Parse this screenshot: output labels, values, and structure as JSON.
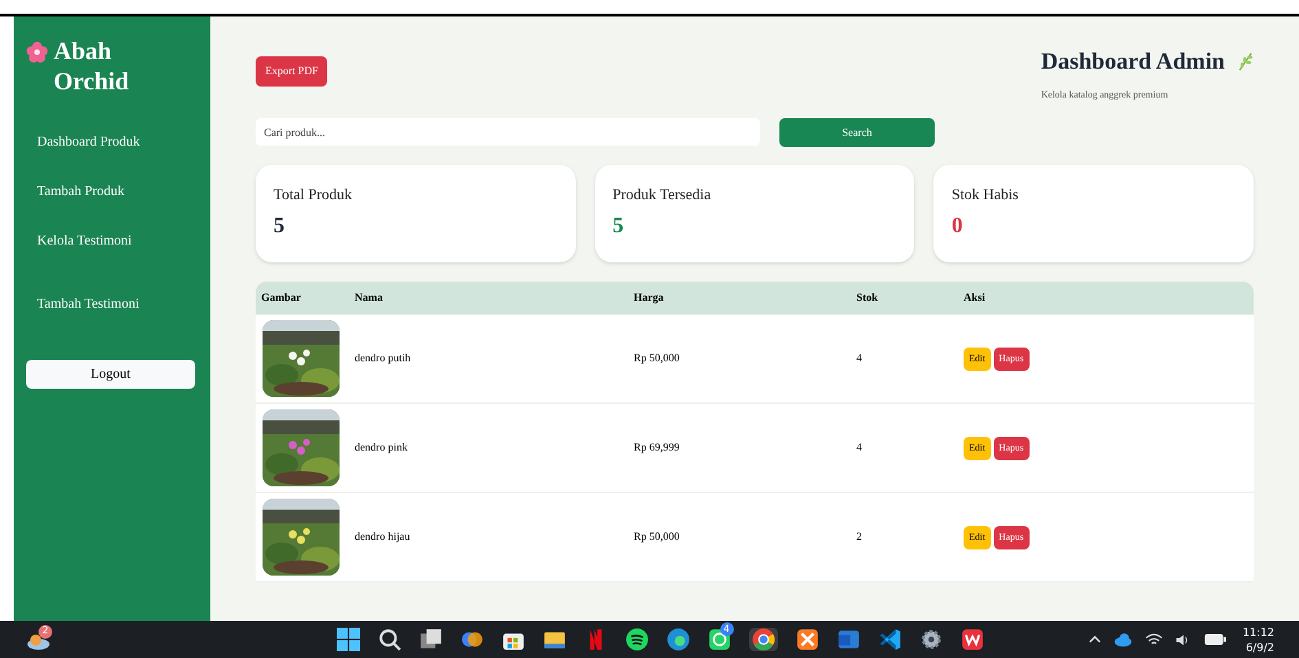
{
  "sidebar": {
    "brand": "Abah Orchid",
    "items": [
      {
        "label": "Dashboard Produk"
      },
      {
        "label": "Tambah Produk"
      },
      {
        "label": "Kelola Testimoni"
      },
      {
        "label": "Tambah Testimoni"
      }
    ],
    "logout": "Logout"
  },
  "header": {
    "export_button": "Export PDF",
    "title": "Dashboard Admin",
    "subtitle": "Kelola katalog anggrek premium"
  },
  "search": {
    "placeholder": "Cari produk...",
    "button": "Search"
  },
  "stats": [
    {
      "label": "Total Produk",
      "value": "5",
      "color": "#1f2937"
    },
    {
      "label": "Produk Tersedia",
      "value": "5",
      "color": "#198754"
    },
    {
      "label": "Stok Habis",
      "value": "0",
      "color": "#dc3545"
    }
  ],
  "table": {
    "columns": [
      "Gambar",
      "Nama",
      "Harga",
      "Stok",
      "Aksi"
    ],
    "rows": [
      {
        "name": "dendro putih",
        "price": "Rp 50,000",
        "stock": "4",
        "edit": "Edit",
        "delete": "Hapus"
      },
      {
        "name": "dendro pink",
        "price": "Rp 69,999",
        "stock": "4",
        "edit": "Edit",
        "delete": "Hapus"
      },
      {
        "name": "dendro hijau",
        "price": "Rp 50,000",
        "stock": "2",
        "edit": "Edit",
        "delete": "Hapus"
      }
    ]
  },
  "taskbar": {
    "weather_badge": "2",
    "whatsapp_badge": "4",
    "time": "11:12",
    "date": "6/9/2"
  }
}
